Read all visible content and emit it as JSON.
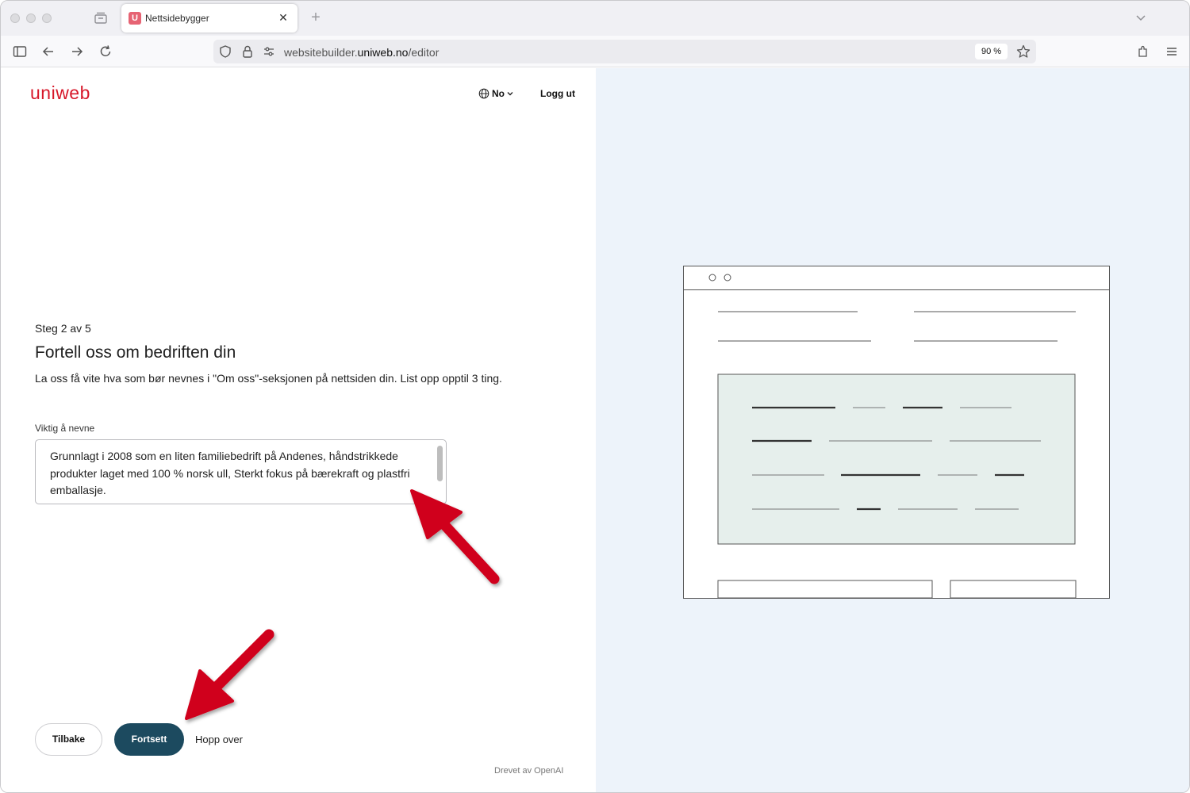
{
  "browser": {
    "tab": {
      "favicon": "U",
      "title": "Nettsidebygger"
    },
    "url": {
      "prefix": "websitebuilder.",
      "domain": "uniweb.no",
      "path": "/editor"
    },
    "zoom": "90 %",
    "icons": [
      "sidebar-icon",
      "back-arrow-icon",
      "forward-arrow-icon",
      "reload-icon",
      "shield-icon",
      "lock-icon",
      "permissions-icon",
      "star-icon",
      "extensions-icon",
      "menu-icon"
    ]
  },
  "header": {
    "logo": "uniweb",
    "language": "No",
    "logout": "Logg ut"
  },
  "form": {
    "step": "Steg 2 av 5",
    "title": "Fortell oss om bedriften din",
    "description": "La oss få vite hva som bør nevnes i \"Om oss\"-seksjonen på nettsiden din. List opp opptil 3 ting.",
    "field_label": "Viktig å nevne",
    "field_value": "Grunnlagt i 2008 som en liten familiebedrift på Andenes, håndstrikkede produkter laget med 100 % norsk ull, Sterkt fokus på bærekraft og plastfri emballasje."
  },
  "actions": {
    "back": "Tilbake",
    "continue": "Fortsett",
    "skip": "Hopp over"
  },
  "footer": {
    "powered_by": "Drevet av OpenAI"
  },
  "colors": {
    "brand": "#d7182a",
    "primary_button": "#1c4a5f",
    "preview_bg": "#edf3fa",
    "preview_panel": "#e6efec",
    "annotation_arrow": "#d0021b"
  }
}
